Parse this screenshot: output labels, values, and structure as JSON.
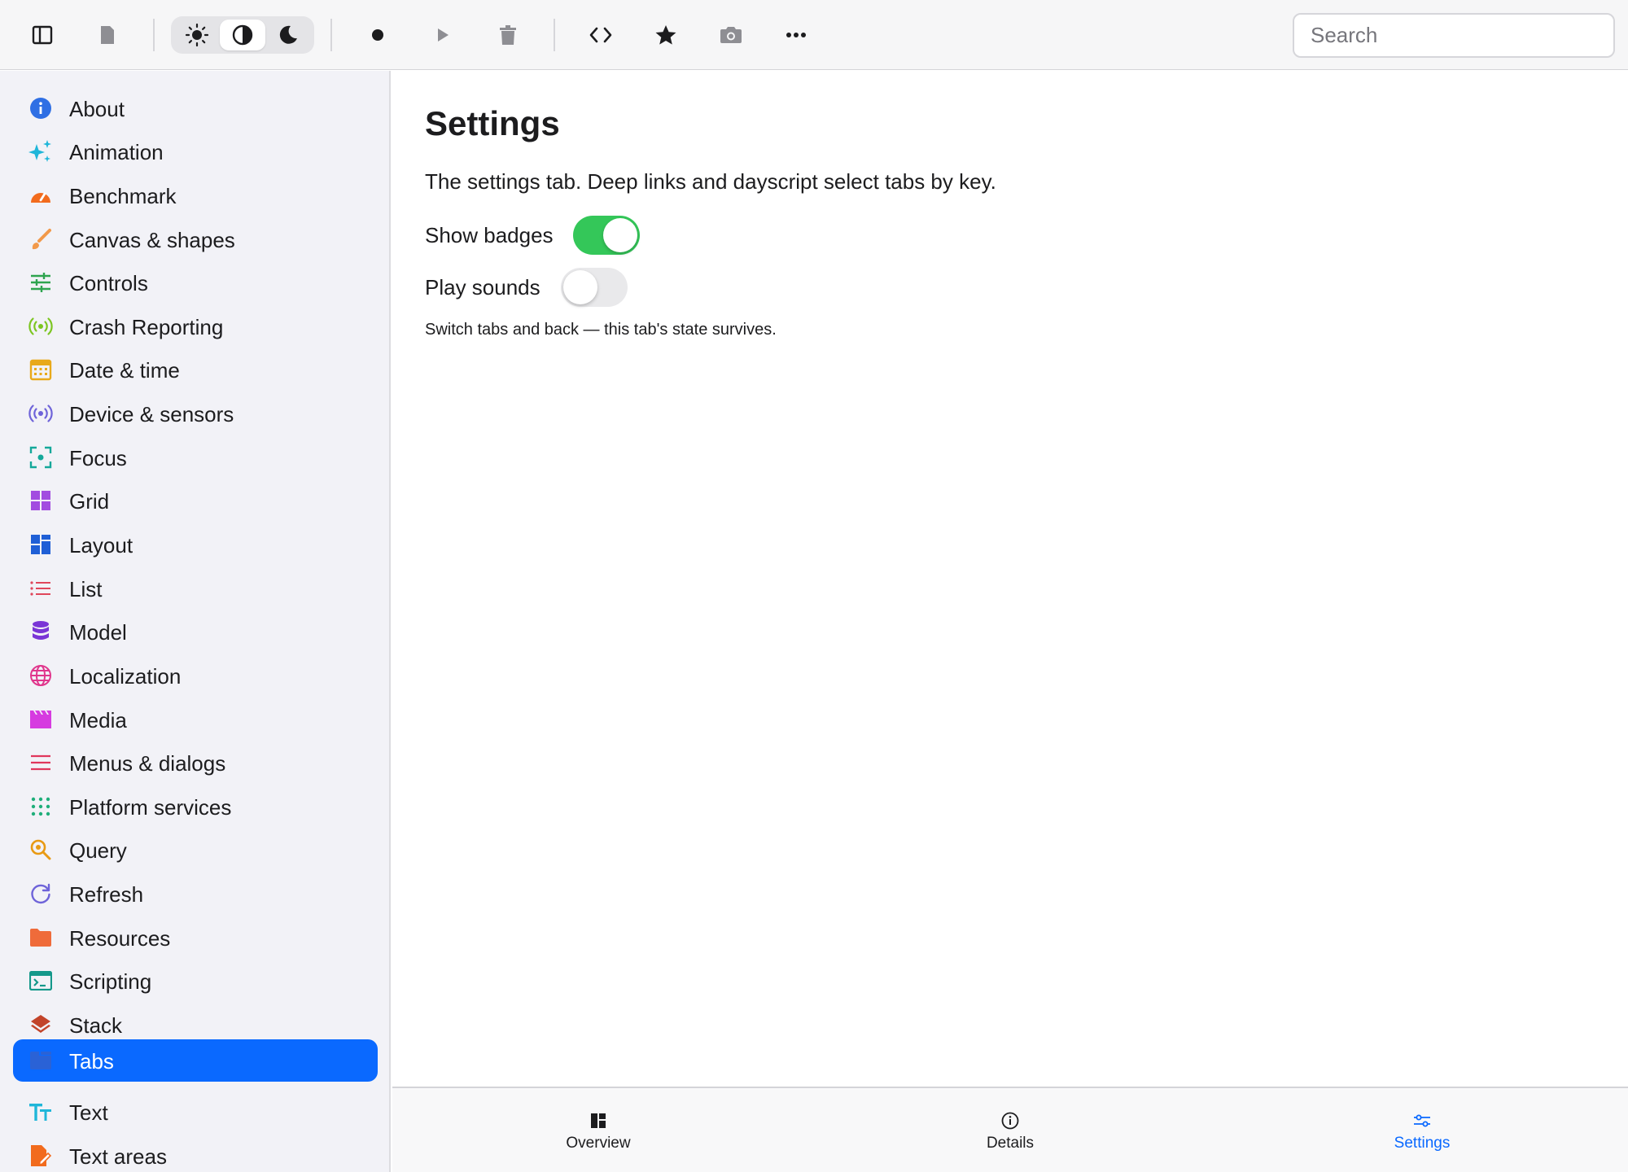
{
  "toolbar": {
    "icons": [
      "sidebar-toggle-icon",
      "document-icon",
      "sun-icon",
      "contrast-icon",
      "moon-icon",
      "record-icon",
      "play-icon",
      "trash-icon",
      "code-icon",
      "star-icon",
      "camera-icon",
      "more-icon"
    ],
    "appearance_selected": "auto",
    "search_placeholder": "Search"
  },
  "sidebar": {
    "selected": "Tabs",
    "items": [
      {
        "label": "About",
        "icon": "info-icon",
        "color": "#2f6fe4"
      },
      {
        "label": "Animation",
        "icon": "sparkles-icon",
        "color": "#1fb6d9"
      },
      {
        "label": "Benchmark",
        "icon": "gauge-icon",
        "color": "#f26b1d"
      },
      {
        "label": "Canvas & shapes",
        "icon": "paintbrush-icon",
        "color": "#f2994a"
      },
      {
        "label": "Controls",
        "icon": "sliders-icon",
        "color": "#2ea44f"
      },
      {
        "label": "Crash Reporting",
        "icon": "broadcast-icon",
        "color": "#7cc521"
      },
      {
        "label": "Date & time",
        "icon": "calendar-icon",
        "color": "#e8a91a"
      },
      {
        "label": "Device & sensors",
        "icon": "sensor-icon",
        "color": "#6e63d9"
      },
      {
        "label": "Focus",
        "icon": "viewfinder-icon",
        "color": "#14a89a"
      },
      {
        "label": "Grid",
        "icon": "grid-icon",
        "color": "#a24de0"
      },
      {
        "label": "Layout",
        "icon": "layout-icon",
        "color": "#1f5fd6"
      },
      {
        "label": "List",
        "icon": "list-icon",
        "color": "#e0475b"
      },
      {
        "label": "Model",
        "icon": "database-icon",
        "color": "#7a35d6"
      },
      {
        "label": "Localization",
        "icon": "globe-icon",
        "color": "#e0368c"
      },
      {
        "label": "Media",
        "icon": "clapper-icon",
        "color": "#d63be0"
      },
      {
        "label": "Menus & dialogs",
        "icon": "menu-icon",
        "color": "#e0365b"
      },
      {
        "label": "Platform services",
        "icon": "dots-grid-icon",
        "color": "#1fae7a"
      },
      {
        "label": "Query",
        "icon": "magnifier-icon",
        "color": "#e89a14"
      },
      {
        "label": "Refresh",
        "icon": "refresh-icon",
        "color": "#6e63d9"
      },
      {
        "label": "Resources",
        "icon": "folder-icon",
        "color": "#ef6b3a"
      },
      {
        "label": "Scripting",
        "icon": "terminal-icon",
        "color": "#14988a"
      },
      {
        "label": "Stack",
        "icon": "stack-icon",
        "color": "#c2442a"
      },
      {
        "label": "Tabs",
        "icon": "tabs-icon",
        "color": "#2a62d6"
      },
      {
        "label": "Text",
        "icon": "text-size-icon",
        "color": "#1fb6d9"
      },
      {
        "label": "Text areas",
        "icon": "doc-edit-icon",
        "color": "#f26b1d"
      }
    ]
  },
  "main": {
    "title": "Settings",
    "description": "The settings tab. Deep links and dayscript select tabs by key.",
    "toggles": [
      {
        "label": "Show badges",
        "on": true
      },
      {
        "label": "Play sounds",
        "on": false
      }
    ],
    "hint": "Switch tabs and back — this tab's state survives."
  },
  "tabbar": {
    "active": "Settings",
    "tabs": [
      {
        "label": "Overview",
        "icon": "overview-icon"
      },
      {
        "label": "Details",
        "icon": "info-circle-icon"
      },
      {
        "label": "Settings",
        "icon": "settings-sliders-icon"
      }
    ]
  },
  "colors": {
    "accent": "#0a69ff",
    "toggle_on": "#34c759",
    "toggle_off": "#e9e9eb"
  }
}
